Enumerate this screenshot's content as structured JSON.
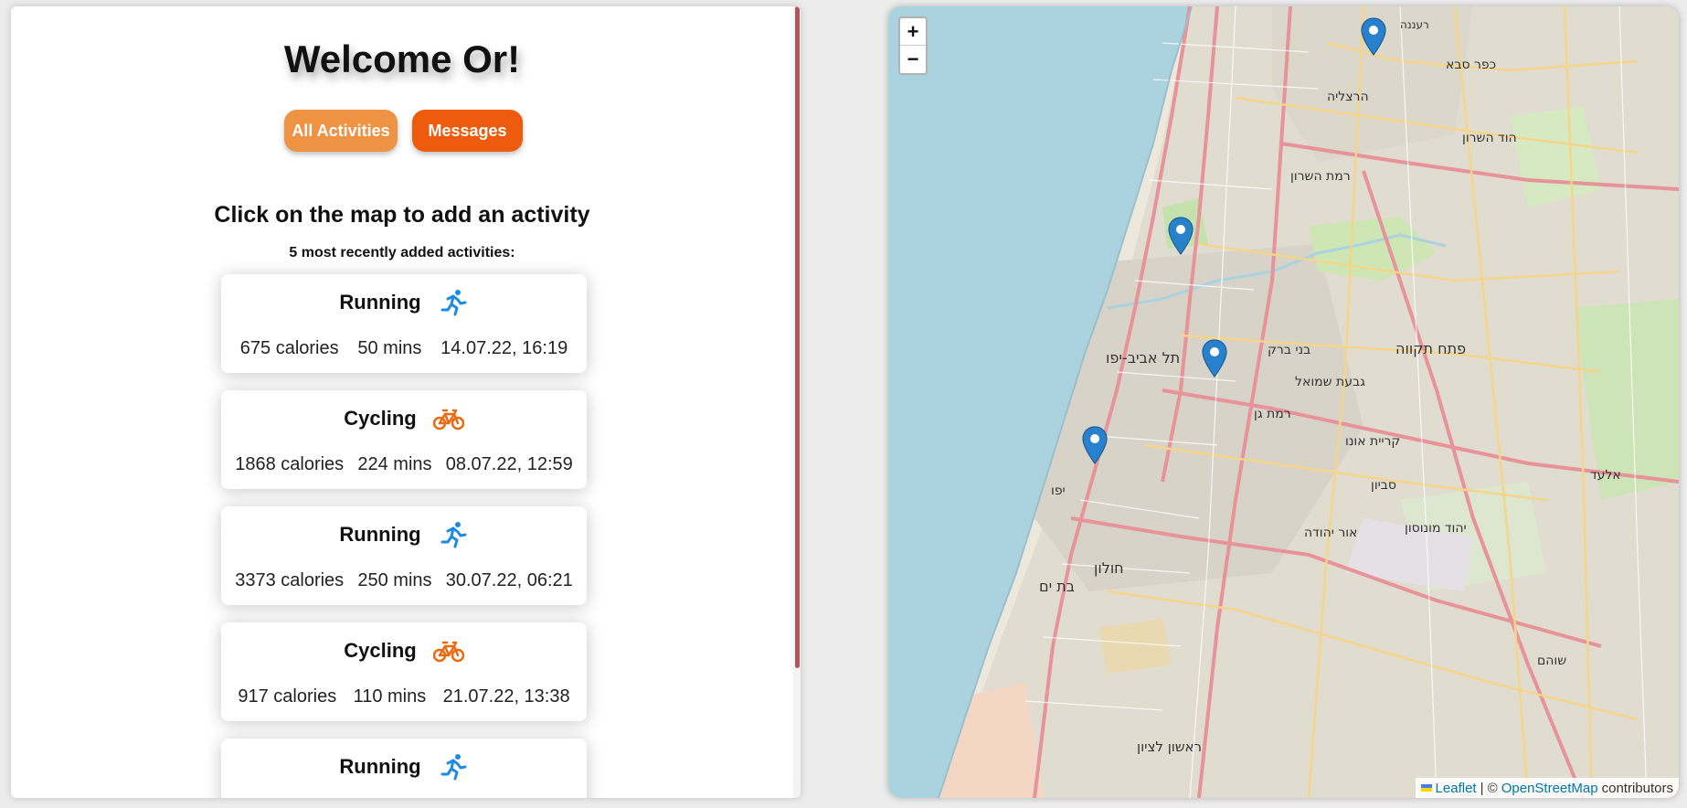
{
  "header": {
    "welcome": "Welcome Or!"
  },
  "nav": {
    "all_activities": "All Activities",
    "messages": "Messages"
  },
  "prompt": "Click on the map to add an activity",
  "recent_label": "5 most recently added activities:",
  "activities": [
    {
      "type": "Running",
      "icon": "running-icon",
      "calories": "675 calories",
      "duration": "50 mins",
      "date": "14.07.22, 16:19"
    },
    {
      "type": "Cycling",
      "icon": "bicycle-icon",
      "calories": "1868 calories",
      "duration": "224 mins",
      "date": "08.07.22, 12:59"
    },
    {
      "type": "Running",
      "icon": "running-icon",
      "calories": "3373 calories",
      "duration": "250 mins",
      "date": "30.07.22, 06:21"
    },
    {
      "type": "Cycling",
      "icon": "bicycle-icon",
      "calories": "917 calories",
      "duration": "110 mins",
      "date": "21.07.22, 13:38"
    },
    {
      "type": "Running",
      "icon": "running-icon",
      "calories": "",
      "duration": "",
      "date": ""
    }
  ],
  "map": {
    "zoom_in": "+",
    "zoom_out": "−",
    "attribution_leaflet": "Leaflet",
    "attribution_sep": "| ©",
    "attribution_osm": "OpenStreetMap",
    "attribution_suffix": "contributors",
    "labels": [
      "הרצליה",
      "כפר סבא",
      "רעננה",
      "הוד השרון",
      "רמת השרון",
      "תל אביב-יפו",
      "בני ברק",
      "פתח תקווה",
      "רמת גן",
      "גבעת שמואל",
      "קריית אונו",
      "אור יהודה",
      "יהוד מונוסון",
      "חולון",
      "בת ים",
      "ראשון לציון",
      "אלעד",
      "שוהם",
      "יפו",
      "סביון"
    ]
  },
  "colors": {
    "all_btn": "#ee9244",
    "msg_btn": "#ef5b0c",
    "running_icon": "#1e8be3",
    "cycling_icon": "#ea6a10",
    "marker": "#2a81cb",
    "sea": "#aad3df",
    "scrollbar": "#b0575b"
  }
}
